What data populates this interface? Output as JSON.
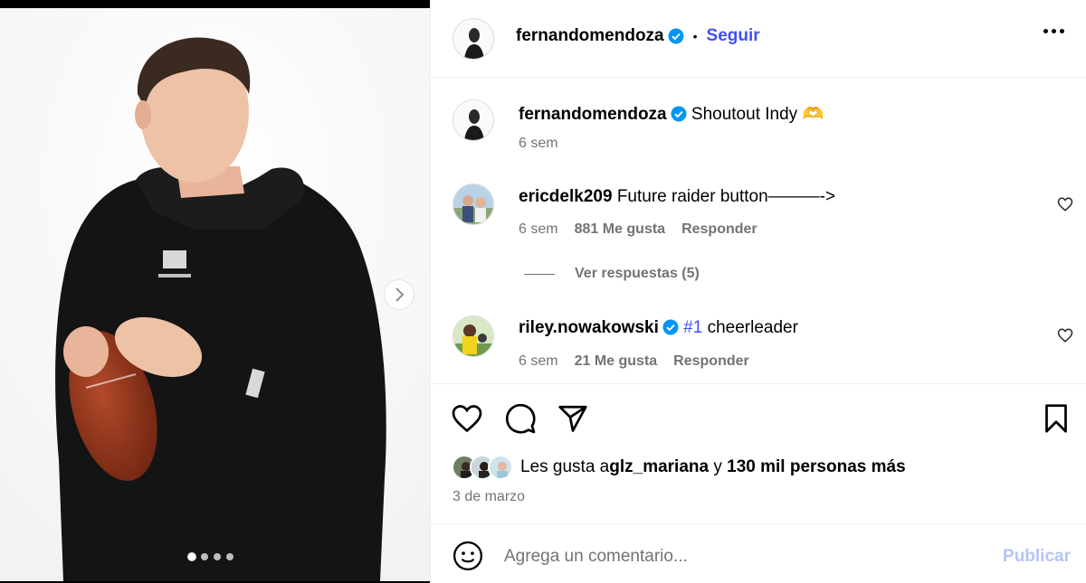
{
  "post": {
    "author": "fernandomendoza",
    "follow_label": "Seguir",
    "separator": "•",
    "carousel": {
      "total": 4,
      "current": 1
    }
  },
  "caption": {
    "username": "fernandomendoza",
    "text": "Shoutout Indy",
    "emoji": "🫶",
    "time": "6 sem"
  },
  "comments": [
    {
      "username": "ericdelk209",
      "text": "Future raider button———->",
      "time": "6 sem",
      "likes": "881 Me gusta",
      "reply_label": "Responder"
    },
    {
      "username": "riley.nowakowski",
      "hashtag": "#1",
      "text": " cheerleader",
      "time": "6 sem",
      "likes": "21 Me gusta",
      "reply_label": "Responder"
    }
  ],
  "view_replies": "Ver respuestas (5)",
  "likes": {
    "prefix": "Les gusta a ",
    "first_user": "glz_mariana",
    "connector": " y ",
    "others": "130 mil personas más"
  },
  "date": "3 de marzo",
  "composer": {
    "placeholder": "Agrega un comentario...",
    "post_label": "Publicar"
  },
  "icons": [
    "chevron-right-icon",
    "more-icon",
    "verified-icon",
    "heart-icon",
    "comment-icon",
    "share-icon",
    "bookmark-icon",
    "emoji-icon"
  ],
  "colors": {
    "accent": "#4150f7",
    "verified": "#0095f6",
    "muted": "#737373",
    "post_disabled": "#b3c5f9"
  }
}
